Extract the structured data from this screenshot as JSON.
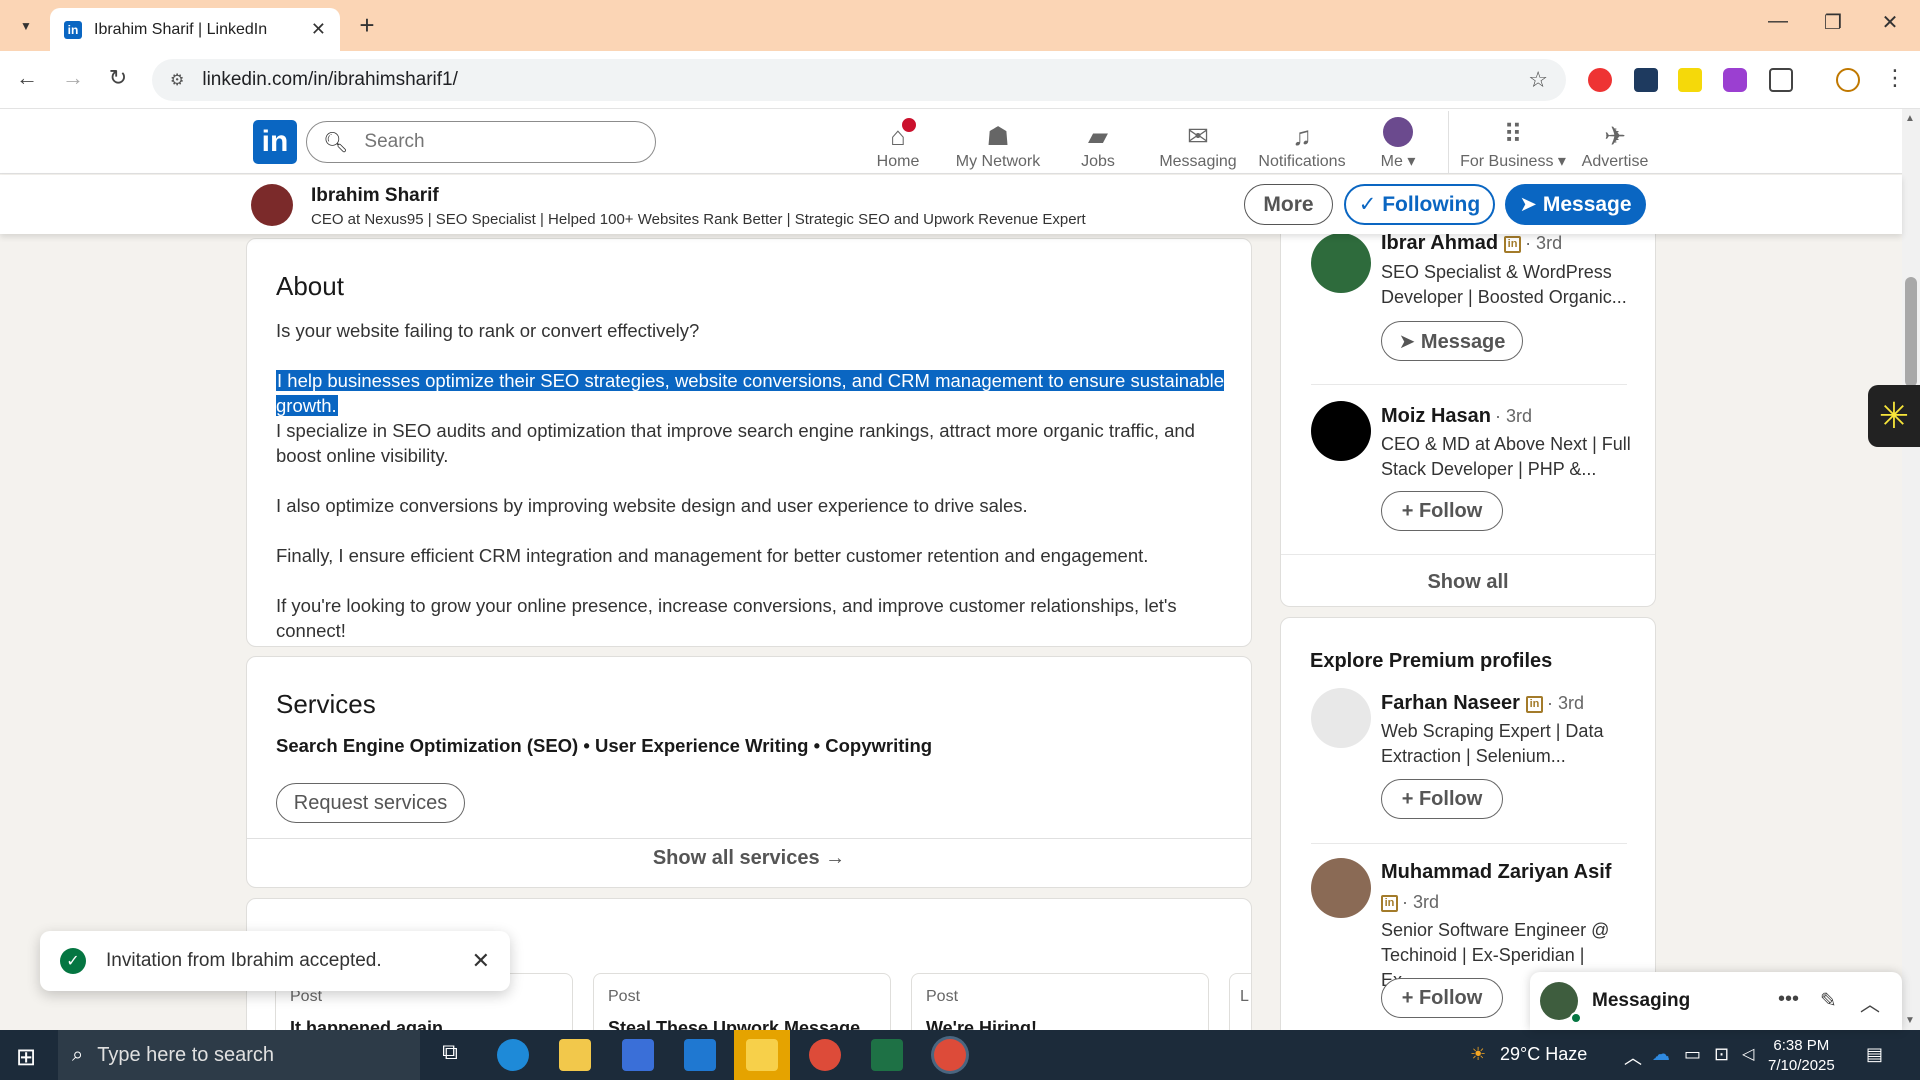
{
  "browser": {
    "tab_title": "Ibrahim Sharif | LinkedIn",
    "tab_favicon": "in",
    "url": "linkedin.com/in/ibrahimsharif1/"
  },
  "li_nav": {
    "search_placeholder": "Search",
    "items": [
      {
        "label": "Home",
        "icon": "home-icon"
      },
      {
        "label": "My Network",
        "icon": "network-icon"
      },
      {
        "label": "Jobs",
        "icon": "jobs-icon"
      },
      {
        "label": "Messaging",
        "icon": "messaging-icon"
      },
      {
        "label": "Notifications",
        "icon": "bell-icon"
      },
      {
        "label": "Me ▾",
        "icon": "avatar"
      },
      {
        "label": "For Business ▾",
        "icon": "grid-icon"
      },
      {
        "label": "Advertise",
        "icon": "megaphone-icon"
      }
    ]
  },
  "profile_bar": {
    "name": "Ibrahim Sharif",
    "headline": "CEO at Nexus95 | SEO Specialist | Helped 100+ Websites Rank Better | Strategic SEO and Upwork Revenue Expert",
    "more_label": "More",
    "following_label": "✓ Following",
    "message_label": "➤ Message"
  },
  "about": {
    "title": "About",
    "p1": "Is your website failing to rank or convert effectively?",
    "p2_highlighted": "I help businesses optimize their SEO strategies, website conversions, and CRM management to ensure sustainable growth.",
    "p3": "I specialize in SEO audits and optimization that improve search engine rankings, attract more organic traffic, and boost online visibility.",
    "p4": "I also optimize conversions by improving website design and user experience to drive sales.",
    "p5": "Finally, I ensure efficient CRM integration and management for better customer retention and engagement.",
    "p6": "If you're looking to grow your online presence, increase conversions, and improve customer relationships, let's connect!"
  },
  "services": {
    "title": "Services",
    "list": "Search Engine Optimization (SEO) • User Experience Writing • Copywriting",
    "request_label": "Request services",
    "show_all_label": "Show all services →"
  },
  "featured": {
    "posts": [
      {
        "label": "Post",
        "title": "It happened again"
      },
      {
        "label": "Post",
        "title": "Steal These Upwork Message"
      },
      {
        "label": "Post",
        "title": "We're Hiring!"
      },
      {
        "label": "L",
        "title": ""
      }
    ]
  },
  "sidebar": {
    "people": [
      {
        "name": "Ibrar Ahmad",
        "degree": "· 3rd",
        "headline": "SEO Specialist & WordPress Developer | Boosted Organic...",
        "button": "➤ Message"
      },
      {
        "name": "Moiz Hasan",
        "degree": "· 3rd",
        "headline": "CEO & MD at Above Next | Full Stack Developer | PHP &...",
        "button": "+ Follow"
      }
    ],
    "show_all_label": "Show all",
    "premium_title": "Explore Premium profiles",
    "premium": [
      {
        "name": "Farhan Naseer",
        "degree": "· 3rd",
        "headline": "Web Scraping Expert | Data Extraction | Selenium...",
        "button": "+ Follow"
      },
      {
        "name": "Muhammad Zariyan Asif",
        "degree": "· 3rd",
        "headline": "Senior Software Engineer @ Techinoid | Ex-Speridian | Ex-...",
        "button": "+ Follow"
      }
    ]
  },
  "toast": {
    "text": "Invitation from Ibrahim accepted."
  },
  "messaging_widget": {
    "label": "Messaging"
  },
  "taskbar": {
    "search_placeholder": "Type here to search",
    "weather": "29°C Haze",
    "time": "6:38 PM",
    "date": "7/10/2025"
  },
  "colors": {
    "linkedin_blue": "#0a66c2",
    "tab_bar": "#fbd5b5",
    "taskbar": "#1c2b3a",
    "premium_gold": "#a37b2a"
  }
}
